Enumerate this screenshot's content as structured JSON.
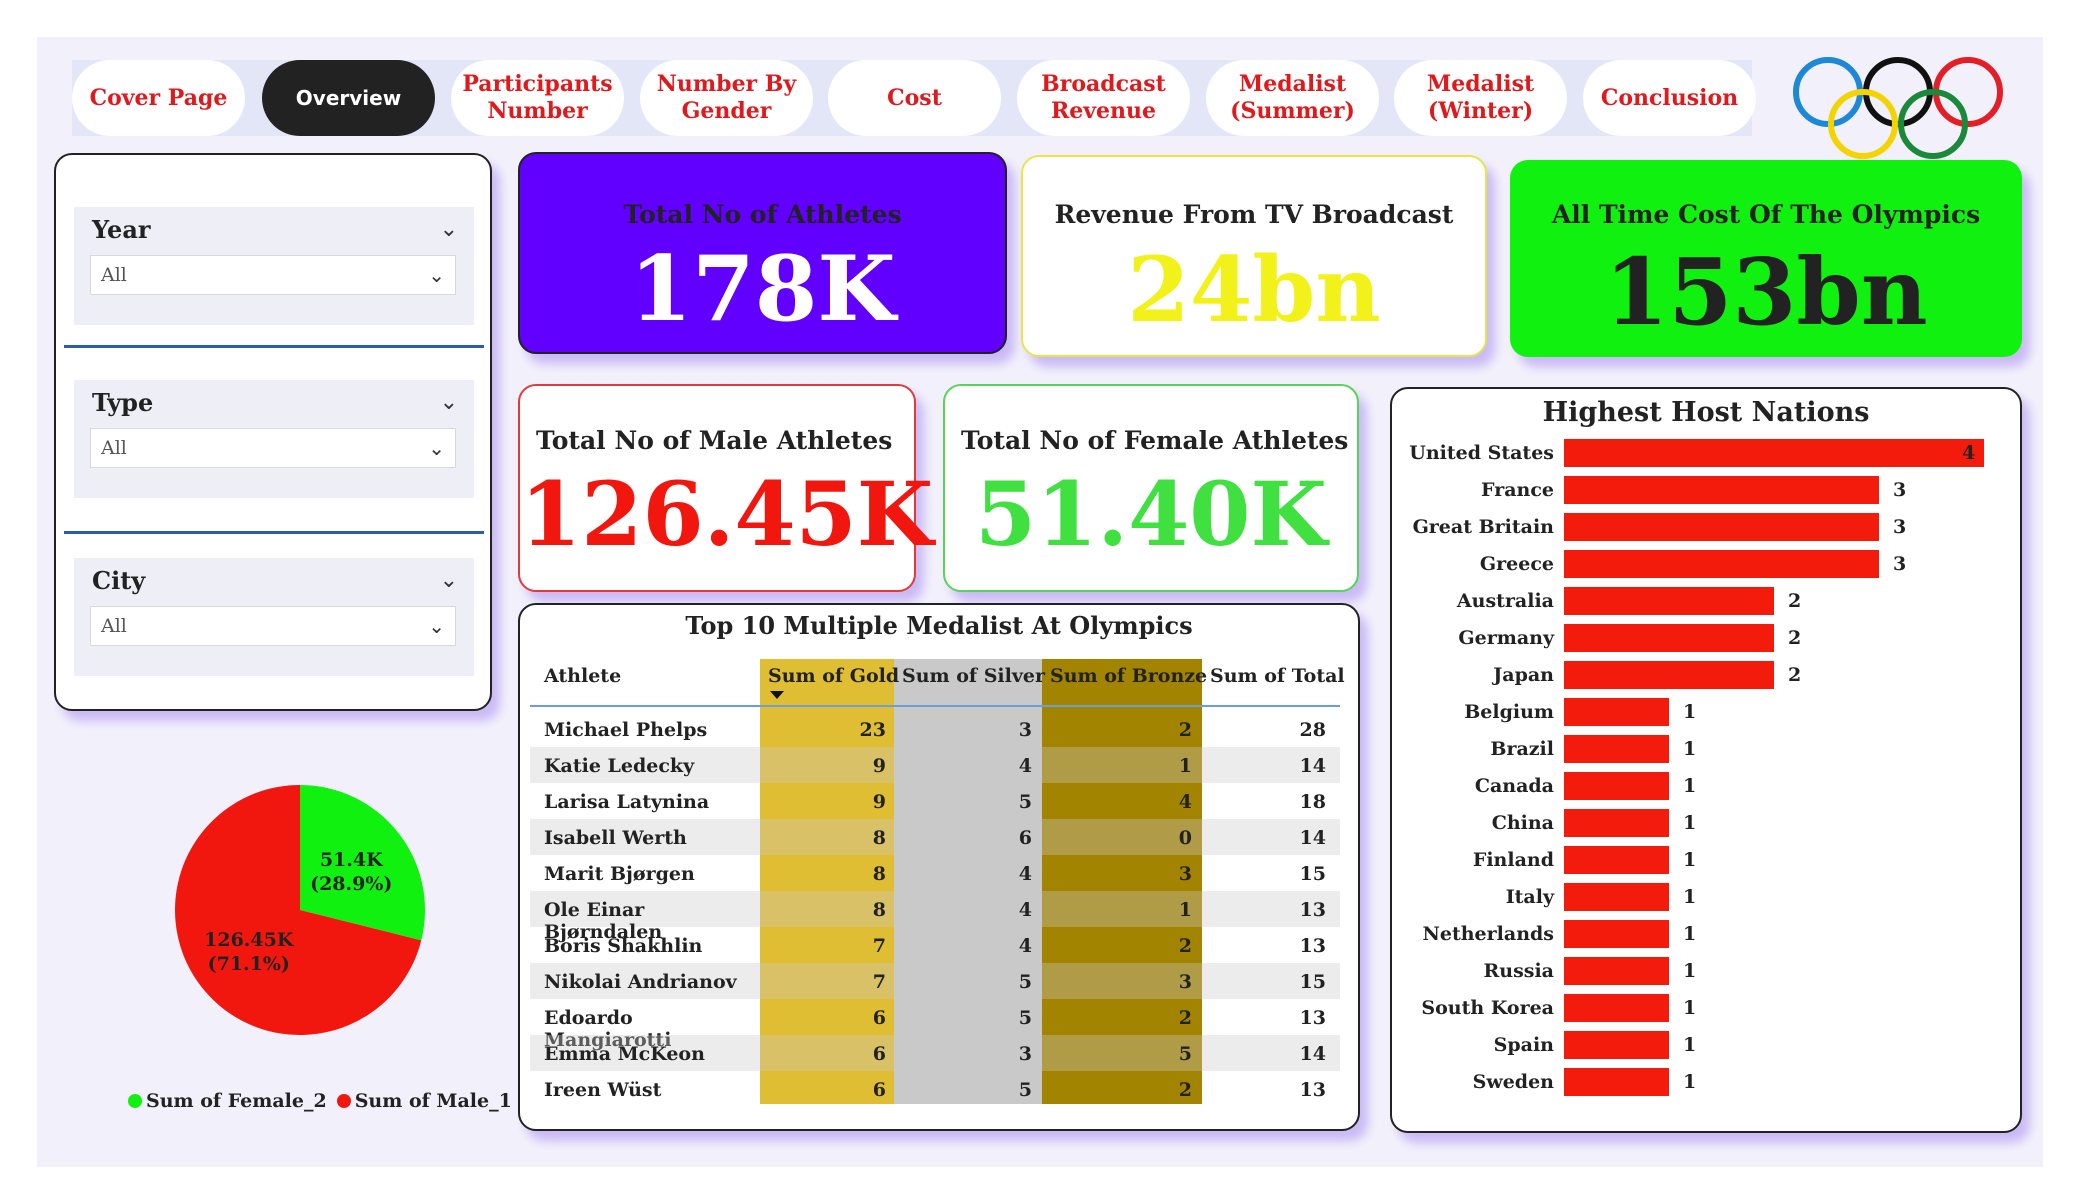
{
  "nav": {
    "items": [
      {
        "label": "Cover Page",
        "active": false
      },
      {
        "label": "Overview",
        "active": true
      },
      {
        "label": "Participants\nNumber",
        "active": false
      },
      {
        "label": "Number By\nGender",
        "active": false
      },
      {
        "label": "Cost",
        "active": false
      },
      {
        "label": "Broadcast\nRevenue",
        "active": false
      },
      {
        "label": "Medalist\n(Summer)",
        "active": false
      },
      {
        "label": "Medalist\n(Winter)",
        "active": false
      },
      {
        "label": "Conclusion",
        "active": false
      }
    ]
  },
  "logo": {
    "icon": "olympic-rings-icon",
    "colors": [
      "#1e88d8",
      "#111111",
      "#e41e26",
      "#f4d400",
      "#1a8a3a"
    ]
  },
  "filters": [
    {
      "title": "Year",
      "value": "All"
    },
    {
      "title": "Type",
      "value": "All"
    },
    {
      "title": "City",
      "value": "All"
    }
  ],
  "kpis": {
    "athletes": {
      "title": "Total No of Athletes",
      "value": "178K",
      "color": "#ffffff",
      "bg": "#6100ff"
    },
    "broadcast": {
      "title": "Revenue From TV Broadcast",
      "value": "24bn",
      "color": "#f2f21a"
    },
    "cost": {
      "title": "All Time Cost Of  The Olympics",
      "value": "153bn",
      "color": "#222222",
      "bg": "#11f10f"
    },
    "male": {
      "title": "Total No of Male  Athletes",
      "value": "126.45K",
      "color": "#f2170e"
    },
    "female": {
      "title": "Total No of Female Athletes",
      "value": "51.40K",
      "color": "#3fe03f"
    }
  },
  "table": {
    "title": "Top 10 Multiple Medalist At Olympics",
    "headers": [
      "Athlete",
      "Sum of Gold",
      "Sum of Silver",
      "Sum of Bronze",
      "Sum of Total"
    ],
    "rows": [
      [
        "Michael Phelps",
        "23",
        "3",
        "2",
        "28"
      ],
      [
        "Katie Ledecky",
        "9",
        "4",
        "1",
        "14"
      ],
      [
        "Larisa Latynina",
        "9",
        "5",
        "4",
        "18"
      ],
      [
        "Isabell Werth",
        "8",
        "6",
        "0",
        "14"
      ],
      [
        "Marit Bjørgen",
        "8",
        "4",
        "3",
        "15"
      ],
      [
        "Ole Einar Bjørndalen",
        "8",
        "4",
        "1",
        "13"
      ],
      [
        "Boris Shakhlin",
        "7",
        "4",
        "2",
        "13"
      ],
      [
        "Nikolai Andrianov",
        "7",
        "5",
        "3",
        "15"
      ],
      [
        "Edoardo Mangiarotti",
        "6",
        "5",
        "2",
        "13"
      ],
      [
        "Emma McKeon",
        "6",
        "3",
        "5",
        "14"
      ],
      [
        "Ireen Wüst",
        "6",
        "5",
        "2",
        "13"
      ]
    ]
  },
  "chart_data": [
    {
      "type": "bar",
      "title": "Highest Host Nations",
      "orientation": "horizontal",
      "categories": [
        "United States",
        "France",
        "Great Britain",
        "Greece",
        "Australia",
        "Germany",
        "Japan",
        "Belgium",
        "Brazil",
        "Canada",
        "China",
        "Finland",
        "Italy",
        "Netherlands",
        "Russia",
        "South Korea",
        "Spain",
        "Sweden"
      ],
      "values": [
        4,
        3,
        3,
        3,
        2,
        2,
        2,
        1,
        1,
        1,
        1,
        1,
        1,
        1,
        1,
        1,
        1,
        1
      ],
      "color": "#f21b0c"
    },
    {
      "type": "pie",
      "slices": [
        {
          "name": "Sum of Female_2",
          "value": 51.4,
          "label": "51.4K",
          "pct": "(28.9%)",
          "color": "#11f10f"
        },
        {
          "name": "Sum of Male_1",
          "value": 126.45,
          "label": "126.45K",
          "pct": "(71.1%)",
          "color": "#f2170e"
        }
      ],
      "legend": "bottom"
    }
  ]
}
